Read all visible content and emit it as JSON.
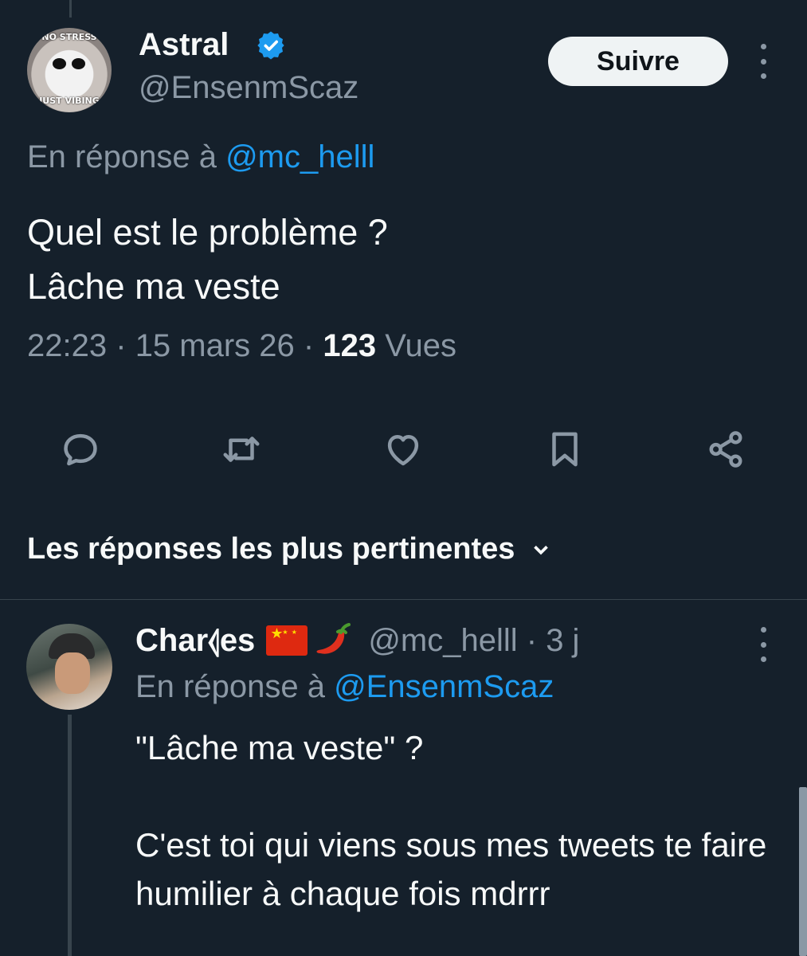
{
  "tweet": {
    "author_name": "Astral",
    "author_handle": "@EnsenmScaz",
    "avatar_text_top": "NO STRESS",
    "avatar_text_bottom": "JUST VIBING",
    "follow_label": "Suivre",
    "replying_prefix": "En réponse à",
    "replying_to": "@mc_helll",
    "text_line1": "Quel est le problème ?",
    "text_line2": "Lâche ma veste",
    "time": "22:23",
    "date": "15 mars 26",
    "views_count": "123",
    "views_label": "Vues"
  },
  "actions": [
    "reply-icon",
    "retweet-icon",
    "like-icon",
    "bookmark-icon",
    "share-icon"
  ],
  "sort_label": "Les réponses les plus pertinentes",
  "reply": {
    "author_name": "Char⦉es",
    "author_handle": "@mc_helll",
    "age": "3 j",
    "replying_prefix": "En réponse à",
    "replying_to": "@EnsenmScaz",
    "text_para1": "\"Lâche ma veste\" ?",
    "text_para2": "C'est toi qui viens sous mes tweets te faire humilier à chaque fois mdrrr"
  },
  "colors": {
    "background": "#15202b",
    "text": "#f7f9f9",
    "muted": "#8b98a5",
    "accent": "#1d9bf0",
    "divider": "#38444d"
  }
}
